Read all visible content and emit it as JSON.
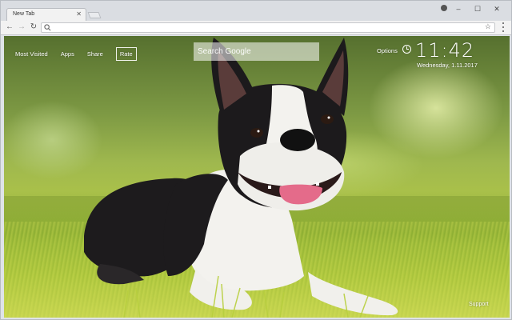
{
  "browser": {
    "tab_title": "New Tab",
    "tab_close_icon": "close-icon",
    "window_controls": [
      "minimize-icon",
      "maximize-icon",
      "close-icon"
    ],
    "profile_icon": "profile-icon",
    "omnibox_placeholder": "",
    "nav_icons": [
      "back-icon",
      "forward-icon",
      "reload-icon"
    ]
  },
  "page": {
    "nav_links": [
      "Most Visited",
      "Apps",
      "Share"
    ],
    "rate_label": "Rate",
    "search_placeholder": "Search Google",
    "options_label": "Options",
    "time": "11:42",
    "date": "Wednesday, 1.11.2017",
    "support_label": "Support",
    "background_description_colors": {
      "grass": "#9fbe3c",
      "dog_black": "#1c1a1c",
      "dog_white": "#f3f2ee"
    }
  }
}
